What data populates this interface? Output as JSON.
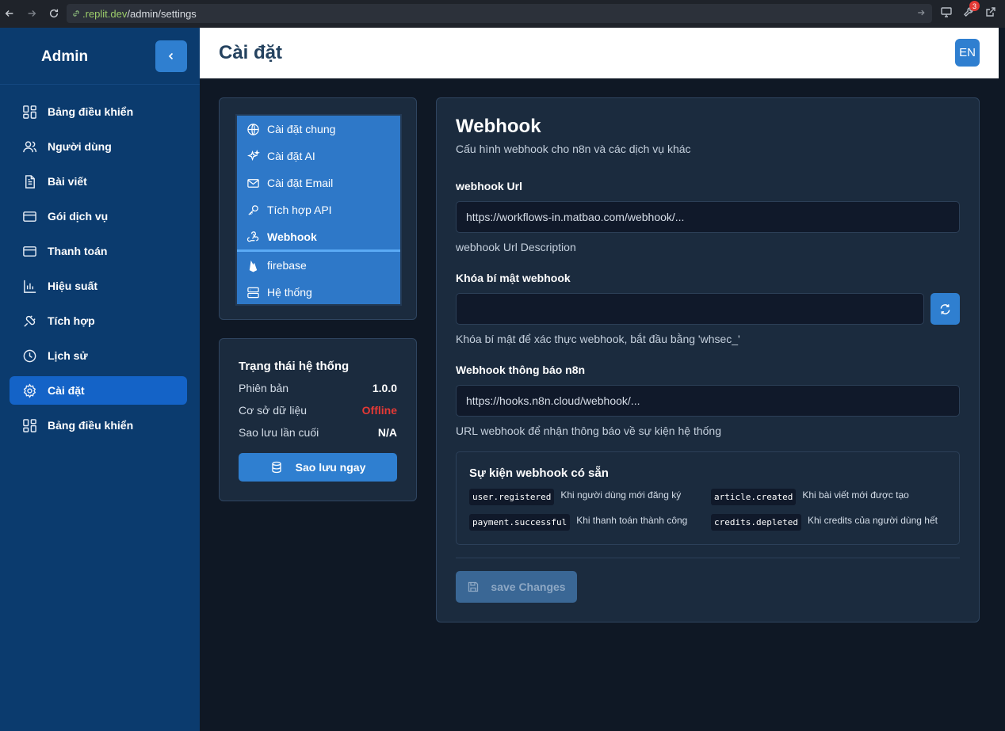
{
  "browser": {
    "url_host": ".replit.dev",
    "url_path": "/admin/settings",
    "notification_count": "3"
  },
  "sidebar": {
    "brand": "Admin",
    "items": [
      {
        "label": "Bảng điều khiển",
        "icon": "dashboard-icon"
      },
      {
        "label": "Người dùng",
        "icon": "users-icon"
      },
      {
        "label": "Bài viết",
        "icon": "document-icon"
      },
      {
        "label": "Gói dịch vụ",
        "icon": "card-icon"
      },
      {
        "label": "Thanh toán",
        "icon": "card-icon"
      },
      {
        "label": "Hiệu suất",
        "icon": "bar-chart-icon"
      },
      {
        "label": "Tích hợp",
        "icon": "plug-icon"
      },
      {
        "label": "Lịch sử",
        "icon": "clock-icon"
      },
      {
        "label": "Cài đặt",
        "icon": "gear-icon",
        "active": true
      },
      {
        "label": "Bảng điều khiển",
        "icon": "dashboard-icon"
      }
    ]
  },
  "header": {
    "title": "Cài đặt",
    "lang": "EN"
  },
  "settings_nav": {
    "items": [
      {
        "label": "Cài đặt chung",
        "icon": "globe-icon"
      },
      {
        "label": "Cài đặt AI",
        "icon": "sparkles-icon"
      },
      {
        "label": "Cài đặt Email",
        "icon": "mail-icon"
      },
      {
        "label": "Tích hợp API",
        "icon": "key-icon"
      },
      {
        "label": "Webhook",
        "icon": "webhook-icon",
        "active": true
      },
      {
        "label": "firebase",
        "icon": "firebase-icon"
      },
      {
        "label": "Hệ thống",
        "icon": "server-icon"
      }
    ]
  },
  "status": {
    "title": "Trạng thái hệ thống",
    "rows": [
      {
        "label": "Phiên bản",
        "value": "1.0.0"
      },
      {
        "label": "Cơ sở dữ liệu",
        "value": "Offline"
      },
      {
        "label": "Sao lưu lần cuối",
        "value": "N/A"
      }
    ],
    "backup_label": "Sao lưu ngay"
  },
  "webhook": {
    "title": "Webhook",
    "subtitle": "Cấu hình webhook cho n8n và các dịch vụ khác",
    "url_label": "webhook Url",
    "url_placeholder": "https://workflows-in.matbao.com/webhook/...",
    "url_desc": "webhook Url Description",
    "secret_label": "Khóa bí mật webhook",
    "secret_value": "",
    "secret_desc": "Khóa bí mật để xác thực webhook, bắt đầu bằng 'whsec_'",
    "notify_label": "Webhook thông báo n8n",
    "notify_placeholder": "https://hooks.n8n.cloud/webhook/...",
    "notify_desc": "URL webhook để nhận thông báo về sự kiện hệ thống",
    "events_title": "Sự kiện webhook có sẵn",
    "events": [
      {
        "code": "user.registered",
        "desc": "Khi người dùng mới đăng ký"
      },
      {
        "code": "article.created",
        "desc": "Khi bài viết mới được tạo"
      },
      {
        "code": "payment.successful",
        "desc": "Khi thanh toán thành công"
      },
      {
        "code": "credits.depleted",
        "desc": "Khi credits của người dùng hết"
      }
    ],
    "save_label": "save Changes"
  }
}
